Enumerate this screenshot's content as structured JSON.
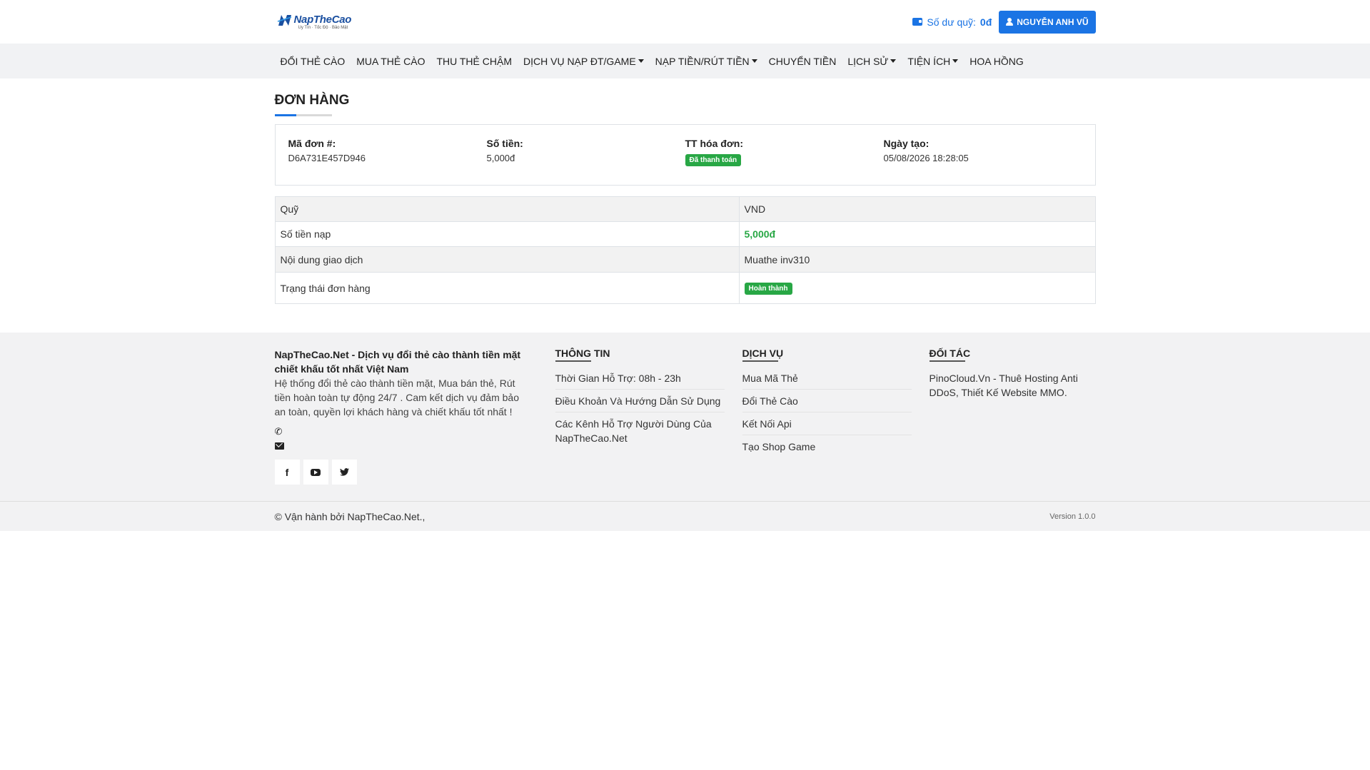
{
  "header": {
    "logo_text": "NapTheCao",
    "logo_tagline": "Uy Tín · Tốc Độ · Bảo Mật",
    "balance_label": "Số dư quỹ:",
    "balance_value": "0đ",
    "user_name": "NGUYỄN ANH VŨ"
  },
  "nav": {
    "items": [
      {
        "label": "ĐỔI THẺ CÀO",
        "dropdown": false
      },
      {
        "label": "MUA THẺ CÀO",
        "dropdown": false
      },
      {
        "label": "THU THẺ CHẬM",
        "dropdown": false
      },
      {
        "label": "DỊCH VỤ NẠP ĐT/GAME",
        "dropdown": true
      },
      {
        "label": "NẠP TIỀN/RÚT TIỀN",
        "dropdown": true
      },
      {
        "label": "CHUYỂN TIỀN",
        "dropdown": false
      },
      {
        "label": "LỊCH SỬ",
        "dropdown": true
      },
      {
        "label": "TIỆN ÍCH",
        "dropdown": true
      },
      {
        "label": "HOA HỒNG",
        "dropdown": false
      }
    ]
  },
  "order": {
    "title": "ĐƠN HÀNG",
    "id_label": "Mã đơn #:",
    "id_value": "D6A731E457D946",
    "amount_label": "Số tiền:",
    "amount_value": "5,000đ",
    "invoice_status_label": "TT hóa đơn:",
    "invoice_status_value": "Đã thanh toán",
    "created_label": "Ngày tạo:",
    "created_value": "05/08/2026 18:28:05"
  },
  "details": {
    "rows": [
      {
        "label": "Quỹ",
        "value": "VND"
      },
      {
        "label": "Số tiền nạp",
        "value": "5,000đ"
      },
      {
        "label": "Nội dung giao dịch",
        "value": "Muathe inv310"
      },
      {
        "label": "Trạng thái đơn hàng",
        "value": "Hoàn thành"
      }
    ]
  },
  "footer": {
    "brand": "NapTheCao.Net - Dịch vụ đổi thẻ cào thành tiền mặt chiết khấu tốt nhất Việt Nam",
    "description": "Hệ thống đổi thẻ cào thành tiền mặt, Mua bán thẻ, Rút tiền hoàn toàn tự động 24/7 . Cam kết dịch vụ đảm bảo an toàn, quyền lợi khách hàng và chiết khấu tốt nhất !",
    "info_heading": "THÔNG TIN",
    "info_links": [
      "Thời Gian Hỗ Trợ: 08h - 23h",
      "Điều Khoản Và Hướng Dẫn Sử Dụng",
      "Các Kênh Hỗ Trợ Người Dùng Của NapTheCao.Net"
    ],
    "service_heading": "DỊCH VỤ",
    "service_links": [
      "Mua Mã Thẻ",
      "Đổi Thẻ Cào",
      "Kết Nối Api",
      "Tạo Shop Game"
    ],
    "partner_heading": "ĐỐI TÁC",
    "partner_text": "PinoCloud.Vn - Thuê Hosting Anti DDoS, Thiết Kế Website MMO.",
    "copyright": "© Vận hành bởi NapTheCao.Net.,",
    "version": "Version 1.0.0"
  },
  "colors": {
    "primary": "#1b74e4",
    "success": "#28a745",
    "nav_bg": "#f1f2f4"
  }
}
